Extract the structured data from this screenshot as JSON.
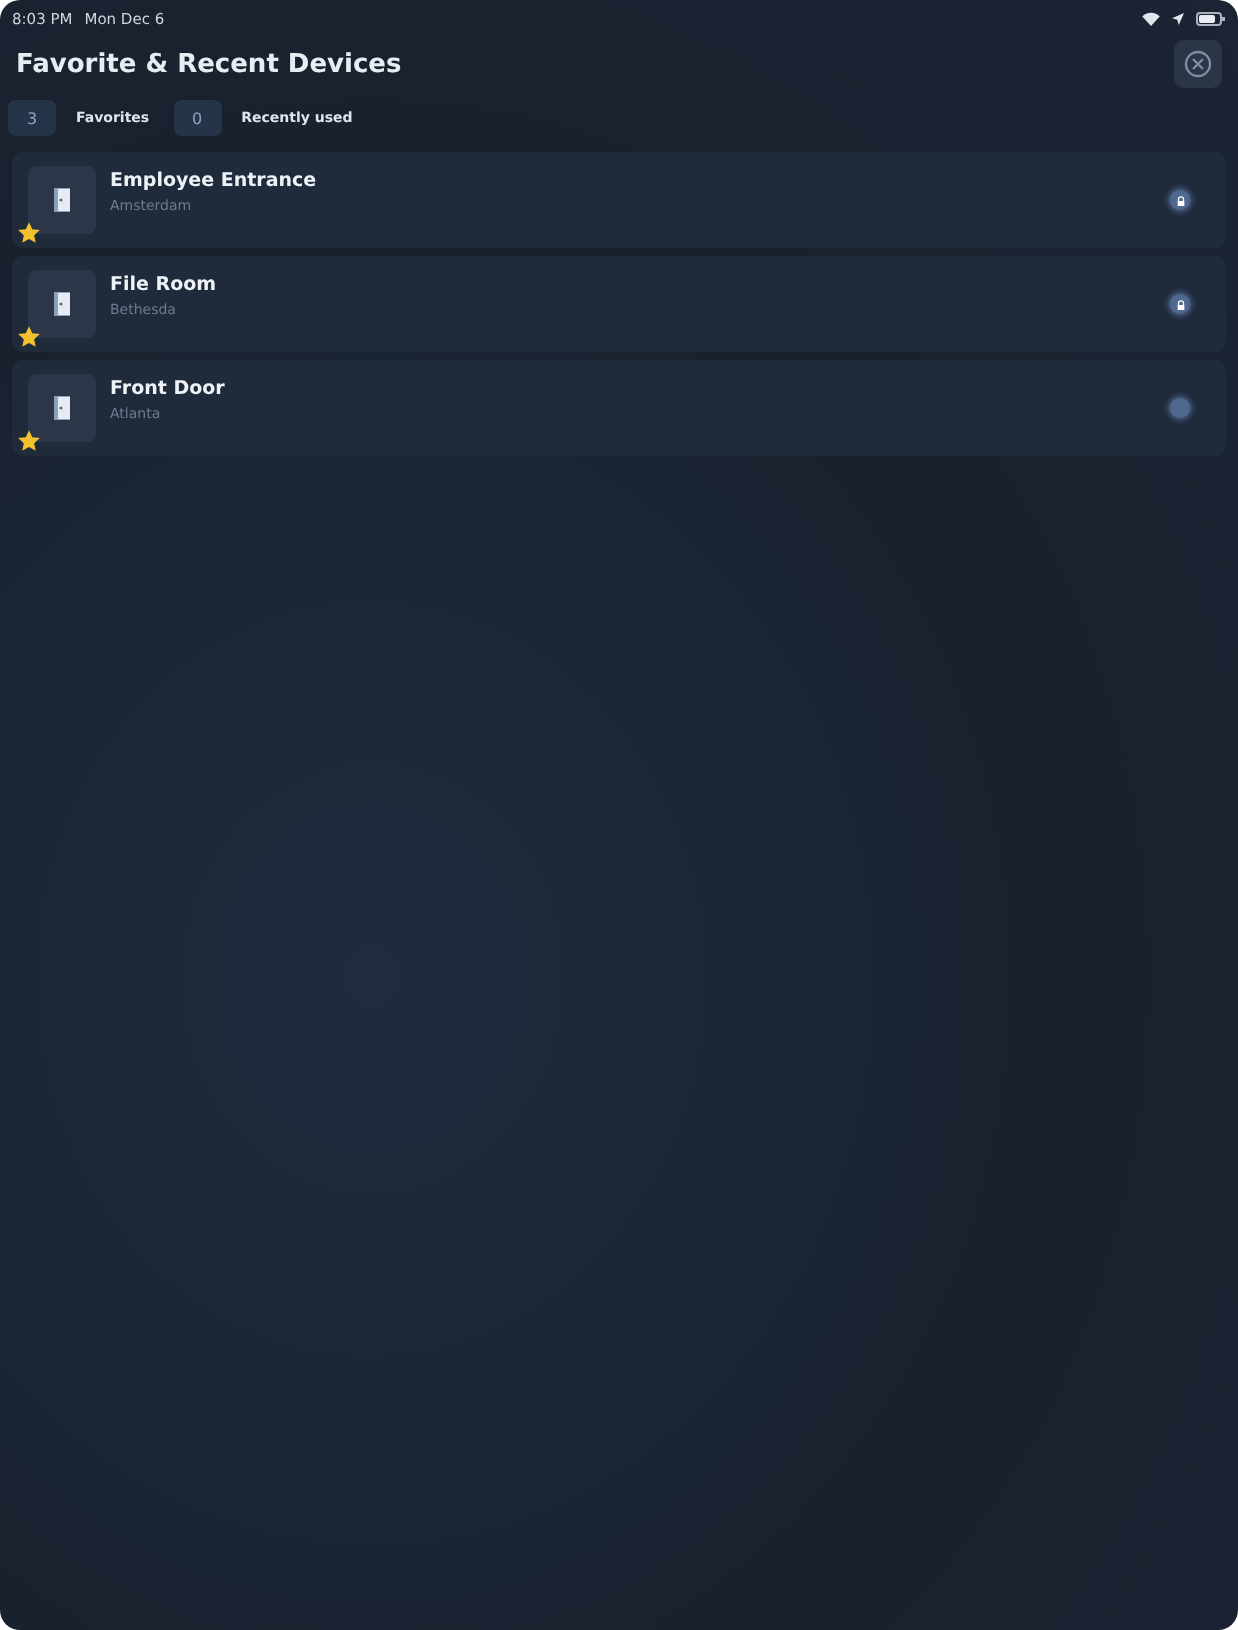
{
  "status_bar": {
    "time": "8:03 PM",
    "date": "Mon Dec 6"
  },
  "title": "Favorite & Recent Devices",
  "filters": [
    {
      "count": "3",
      "label": "Favorites"
    },
    {
      "count": "0",
      "label": "Recently used"
    }
  ],
  "devices": [
    {
      "name": "Employee Entrance",
      "location": "Amsterdam",
      "favorite": true,
      "locked": true
    },
    {
      "name": "File Room",
      "location": "Bethesda",
      "favorite": true,
      "locked": true
    },
    {
      "name": "Front Door",
      "location": "Atlanta",
      "favorite": true,
      "locked": false
    }
  ]
}
